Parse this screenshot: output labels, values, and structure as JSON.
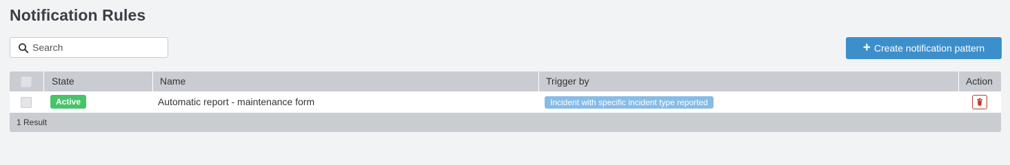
{
  "page": {
    "title": "Notification Rules"
  },
  "search": {
    "placeholder": "Search",
    "value": "",
    "icon": "search-icon"
  },
  "toolbar": {
    "create_label": "Create notification pattern",
    "create_icon": "plus-icon",
    "create_color": "#3d8fcb"
  },
  "table": {
    "columns": [
      "State",
      "Name",
      "Trigger by",
      "Action"
    ],
    "rows": [
      {
        "state": "Active",
        "name": "Automatic report - maintenance form",
        "trigger": "Incident with specific incident type reported",
        "action_icon": "trash-icon"
      }
    ],
    "footer": "1 Result"
  },
  "colors": {
    "active": "#47c36a",
    "trigger_badge": "#86bce7",
    "delete": "#c0392b",
    "header_bg": "#c9ccd1"
  }
}
